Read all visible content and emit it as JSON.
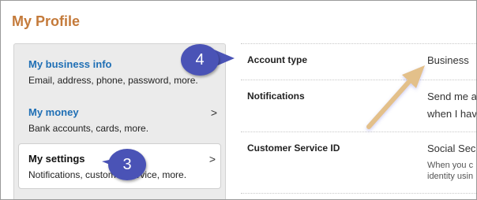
{
  "page_title": "My Profile",
  "sidebar": {
    "items": [
      {
        "title": "My business info",
        "desc": "Email, address, phone, password, more.",
        "chevron": ""
      },
      {
        "title": "My money",
        "desc": "Bank accounts, cards, more.",
        "chevron": ">"
      },
      {
        "title": "My settings",
        "desc": "Notifications, customer service, more.",
        "chevron": ">"
      }
    ]
  },
  "details": {
    "rows": [
      {
        "label": "Account type",
        "value": "Business"
      },
      {
        "label": "Notifications",
        "value_line1": "Send me a",
        "value_line2": "when I hav"
      },
      {
        "label": "Customer Service ID",
        "value_line1": "Social Sec",
        "sub_line1": "When you c",
        "sub_line2": "identity usin"
      }
    ]
  },
  "annotations": {
    "callout_4": "4",
    "callout_3": "3",
    "callout_color": "#4a53b6",
    "arrow_color": "#e3c08a"
  }
}
